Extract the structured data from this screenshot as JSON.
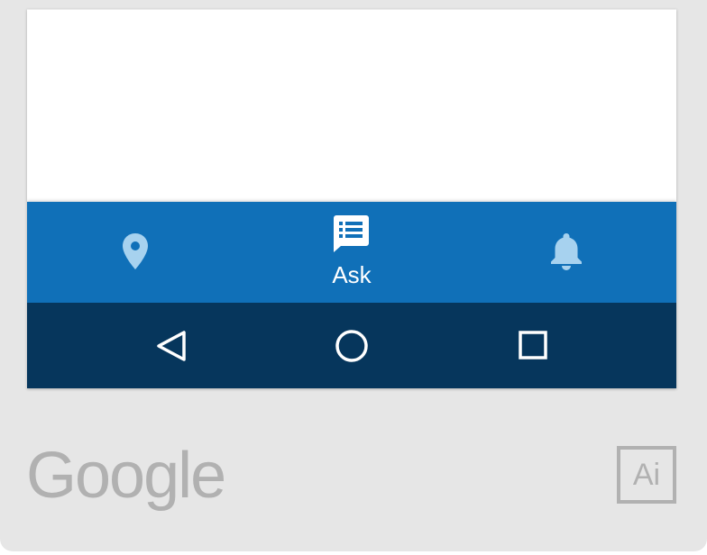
{
  "bottom_nav": {
    "items": [
      {
        "icon": "location-pin-icon",
        "label": ""
      },
      {
        "icon": "chat-list-icon",
        "label": "Ask"
      },
      {
        "icon": "bell-icon",
        "label": ""
      }
    ]
  },
  "system_nav": {
    "back_icon": "triangle-back-icon",
    "home_icon": "circle-home-icon",
    "recents_icon": "square-recents-icon"
  },
  "branding": {
    "logo_text": "Google",
    "badge_text": "Ai"
  },
  "colors": {
    "bottom_nav": "#1070b8",
    "system_nav": "#06365c",
    "inactive_icon": "#a7d2ef",
    "background": "#e6e6e6",
    "brand_gray": "#b1b1b1"
  }
}
